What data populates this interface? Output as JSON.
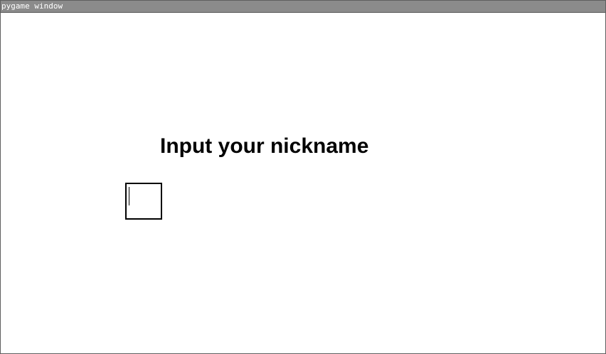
{
  "window": {
    "title": "pygame window"
  },
  "screen": {
    "prompt": "Input your nickname",
    "nickname_input": {
      "value": ""
    }
  }
}
